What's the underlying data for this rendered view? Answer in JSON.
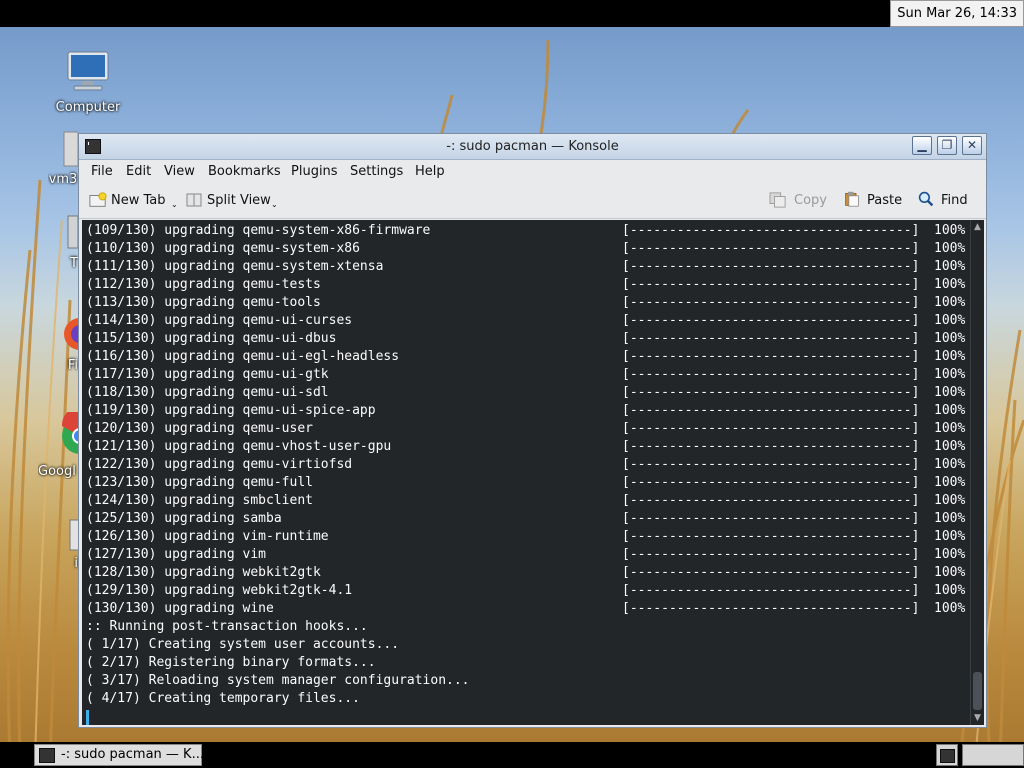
{
  "clock": "Sun Mar 26, 14:33",
  "desktop_icons": [
    {
      "label": "Computer",
      "icon": "computer-icon"
    },
    {
      "label": "vm3",
      "icon": "folder-icon"
    },
    {
      "label": "T",
      "icon": "trash-icon"
    },
    {
      "label": "Fi",
      "icon": "firefox-icon"
    },
    {
      "label": "Googl",
      "icon": "chrome-icon"
    },
    {
      "label": "i",
      "icon": "file-icon"
    }
  ],
  "window": {
    "title": "-: sudo pacman — Konsole",
    "menu": [
      "File",
      "Edit",
      "View",
      "Bookmarks",
      "Plugins",
      "Settings",
      "Help"
    ],
    "toolbar": {
      "new_tab": "New Tab",
      "split_view": "Split View",
      "copy": "Copy",
      "paste": "Paste",
      "find": "Find"
    }
  },
  "terminal": {
    "progress_lines": [
      {
        "text": "(109/130) upgrading qemu-system-x86-firmware",
        "bar": "[------------------------------------]",
        "pct": "100%"
      },
      {
        "text": "(110/130) upgrading qemu-system-x86",
        "bar": "[------------------------------------]",
        "pct": "100%"
      },
      {
        "text": "(111/130) upgrading qemu-system-xtensa",
        "bar": "[------------------------------------]",
        "pct": "100%"
      },
      {
        "text": "(112/130) upgrading qemu-tests",
        "bar": "[------------------------------------]",
        "pct": "100%"
      },
      {
        "text": "(113/130) upgrading qemu-tools",
        "bar": "[------------------------------------]",
        "pct": "100%"
      },
      {
        "text": "(114/130) upgrading qemu-ui-curses",
        "bar": "[------------------------------------]",
        "pct": "100%"
      },
      {
        "text": "(115/130) upgrading qemu-ui-dbus",
        "bar": "[------------------------------------]",
        "pct": "100%"
      },
      {
        "text": "(116/130) upgrading qemu-ui-egl-headless",
        "bar": "[------------------------------------]",
        "pct": "100%"
      },
      {
        "text": "(117/130) upgrading qemu-ui-gtk",
        "bar": "[------------------------------------]",
        "pct": "100%"
      },
      {
        "text": "(118/130) upgrading qemu-ui-sdl",
        "bar": "[------------------------------------]",
        "pct": "100%"
      },
      {
        "text": "(119/130) upgrading qemu-ui-spice-app",
        "bar": "[------------------------------------]",
        "pct": "100%"
      },
      {
        "text": "(120/130) upgrading qemu-user",
        "bar": "[------------------------------------]",
        "pct": "100%"
      },
      {
        "text": "(121/130) upgrading qemu-vhost-user-gpu",
        "bar": "[------------------------------------]",
        "pct": "100%"
      },
      {
        "text": "(122/130) upgrading qemu-virtiofsd",
        "bar": "[------------------------------------]",
        "pct": "100%"
      },
      {
        "text": "(123/130) upgrading qemu-full",
        "bar": "[------------------------------------]",
        "pct": "100%"
      },
      {
        "text": "(124/130) upgrading smbclient",
        "bar": "[------------------------------------]",
        "pct": "100%"
      },
      {
        "text": "(125/130) upgrading samba",
        "bar": "[------------------------------------]",
        "pct": "100%"
      },
      {
        "text": "(126/130) upgrading vim-runtime",
        "bar": "[------------------------------------]",
        "pct": "100%"
      },
      {
        "text": "(127/130) upgrading vim",
        "bar": "[------------------------------------]",
        "pct": "100%"
      },
      {
        "text": "(128/130) upgrading webkit2gtk",
        "bar": "[------------------------------------]",
        "pct": "100%"
      },
      {
        "text": "(129/130) upgrading webkit2gtk-4.1",
        "bar": "[------------------------------------]",
        "pct": "100%"
      },
      {
        "text": "(130/130) upgrading wine",
        "bar": "[------------------------------------]",
        "pct": "100%"
      }
    ],
    "hook_lines": [
      ":: Running post-transaction hooks...",
      "( 1/17) Creating system user accounts...",
      "( 2/17) Registering binary formats...",
      "( 3/17) Reloading system manager configuration...",
      "( 4/17) Creating temporary files..."
    ]
  },
  "taskbar": {
    "task_label": "-: sudo pacman — K..."
  }
}
